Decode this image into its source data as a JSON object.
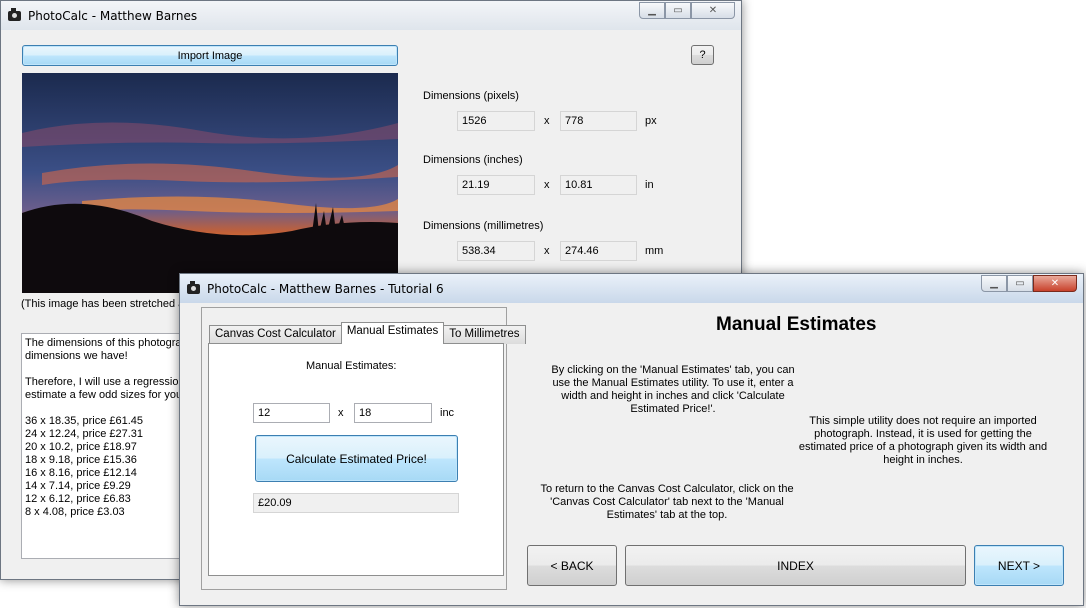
{
  "win1": {
    "title": "PhotoCalc - Matthew Barnes",
    "import_label": "Import Image",
    "help_label": "?",
    "caption": "(This image has been stretched ar",
    "pixels": {
      "label": "Dimensions (pixels)",
      "w": "1526",
      "h": "778",
      "x": "x",
      "unit": "px"
    },
    "inches": {
      "label": "Dimensions (inches)",
      "w": "21.19",
      "h": "10.81",
      "x": "x",
      "unit": "in"
    },
    "mm": {
      "label": "Dimensions (millimetres)",
      "w": "538.34",
      "h": "274.46",
      "x": "x",
      "unit": "mm"
    },
    "text_lines": [
      "The dimensions of this photograp",
      "dimensions we have!",
      "",
      "Therefore, I will use a regression",
      "estimate a few odd sizes for you t",
      "",
      "36 x 18.35, price £61.45",
      "24 x 12.24, price £27.31",
      "20 x 10.2, price £18.97",
      "18 x 9.18, price £15.36",
      "16 x 8.16, price £12.14",
      "14 x 7.14, price £9.29",
      "12 x 6.12, price £6.83",
      "8 x 4.08, price £3.03"
    ]
  },
  "win2": {
    "title": "PhotoCalc - Matthew Barnes - Tutorial 6",
    "tabs": {
      "canvas": "Canvas Cost Calculator",
      "manual": "Manual Estimates",
      "mm": "To Millimetres"
    },
    "manual_label": "Manual Estimates:",
    "width_value": "12",
    "height_value": "18",
    "x": "x",
    "unit": "inc",
    "calc_label": "Calculate Estimated Price!",
    "result": "£20.09",
    "heading": "Manual Estimates",
    "para1": "By clicking on the 'Manual Estimates' tab, you can use the Manual Estimates utility. To use it, enter a width and height in inches and click 'Calculate Estimated Price!'.",
    "para2": "This simple utility does not require an imported photograph. Instead, it is used for getting the estimated price of a photograph given its width and height in inches.",
    "para3": "To return to the Canvas Cost Calculator, click on the 'Canvas Cost Calculator' tab next to the 'Manual Estimates' tab at the top.",
    "back_label": "< BACK",
    "index_label": "INDEX",
    "next_label": "NEXT >"
  },
  "colors": {
    "focus_border": "#3c7fb1",
    "sky_top": "#1d2c52",
    "sunset": "#e0612a"
  }
}
